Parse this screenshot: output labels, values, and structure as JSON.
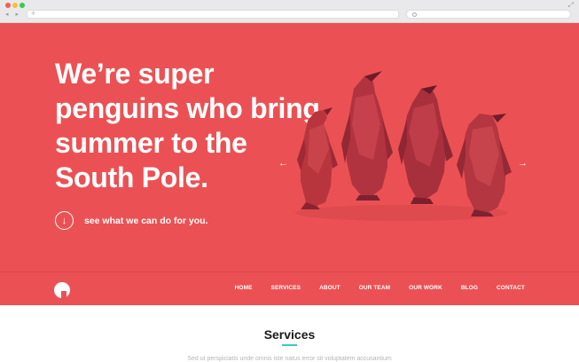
{
  "browser": {
    "back_forward": "◂ ▸",
    "new_tab": "+",
    "expand": "⤢"
  },
  "hero": {
    "headline": "We’re super penguins who bring summer to the South Pole.",
    "cta_icon": "↓",
    "cta_text": "see what we can do for you.",
    "prev_arrow": "←",
    "next_arrow": "→",
    "background_color": "#eb5154"
  },
  "nav": {
    "items": [
      "HOME",
      "SERVICES",
      "ABOUT",
      "OUR TEAM",
      "OUR WORK",
      "BLOG",
      "CONTACT"
    ]
  },
  "services": {
    "title": "Services",
    "subtitle": "Sed ut perspiciatis unde omnis iste natus error sit voluptatem accusantium"
  }
}
